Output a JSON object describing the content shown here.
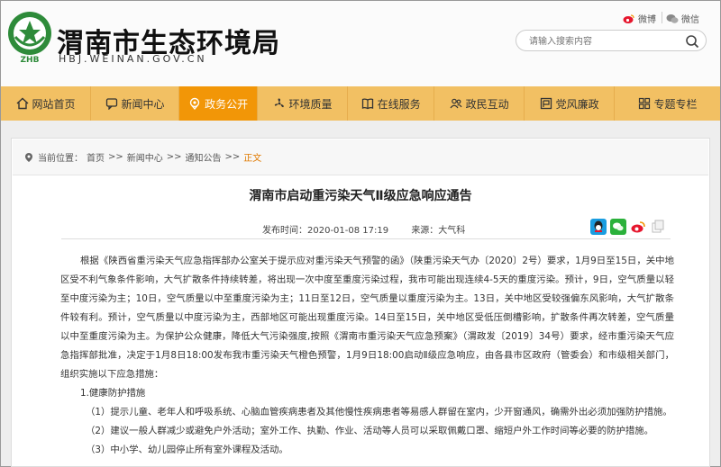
{
  "header": {
    "site_title": "渭南市生态环境局",
    "site_domain": "HBJ.WEINAN.GOV.CN",
    "emblem_text": "ZHB",
    "weibo_label": "微博",
    "wechat_label": "微信",
    "search_placeholder": "请输入搜索内容"
  },
  "nav": {
    "items": [
      {
        "label": "网站首页",
        "icon": "home-icon"
      },
      {
        "label": "新闻中心",
        "icon": "chat-icon"
      },
      {
        "label": "政务公开",
        "icon": "pin-icon",
        "active": true
      },
      {
        "label": "环境质量",
        "icon": "fan-icon"
      },
      {
        "label": "在线服务",
        "icon": "book-icon"
      },
      {
        "label": "政民互动",
        "icon": "people-icon"
      },
      {
        "label": "党风廉政",
        "icon": "flag-icon"
      },
      {
        "label": "专题专栏",
        "icon": "grid-icon"
      }
    ]
  },
  "breadcrumb": {
    "prefix": "当前位置：",
    "items": [
      "首页",
      ">>",
      "新闻中心",
      ">>",
      "通知公告",
      ">>"
    ],
    "current": "正文"
  },
  "article": {
    "title": "渭南市启动重污染天气Ⅱ级应急响应通告",
    "published": "发布时间：2020-01-08 17:19",
    "source": "来源：大气科",
    "paragraph1": "根据《陕西省重污染天气应急指挥部办公室关于提示应对重污染天气预警的函》（陕重污染天气办〔2020〕2号）要求，1月9日至15日，关中地区受不利气象条件影响，大气扩散条件持续转差，将出现一次中度至重度污染过程，我市可能出现连续4-5天的重度污染。预计，9日，空气质量以轻至中度污染为主；10日，空气质量以中至重度污染为主；11日至12日，空气质量以重度污染为主。13日，关中地区受较强偏东风影响，大气扩散条件较有利。预计，空气质量以中度污染为主，西部地区可能出现重度污染。14日至15日，关中地区受低压倒槽影响，扩散条件再次转差，空气质量以中至重度污染为主。为保护公众健康，降低大气污染强度,按照《渭南市重污染天气应急预案》（渭政发〔2019〕34号）要求，经市重污染天气应急指挥部批准，决定于1月8日18:00发布我市重污染天气橙色预警，1月9日18:00启动Ⅱ级应急响应，由各县市区政府（管委会）和市级相关部门，组织实施以下应急措施：",
    "heading1": "1.健康防护措施",
    "item1": "（1）提示儿童、老年人和呼吸系统、心脑血管疾病患者及其他慢性疾病患者等易感人群留在室内，少开窗通风，确需外出必须加强防护措施。",
    "item2": "（2）建议一般人群减少或避免户外活动；室外工作、执勤、作业、活动等人员可以采取佩戴口罩、缩短户外工作时间等必要的防护措施。",
    "item3": "（3）中小学、幼儿园停止所有室外课程及活动。"
  },
  "colors": {
    "nav_bg": "#f2c063",
    "nav_active": "#f29607",
    "emblem_green": "#2e8b3a",
    "crumb_current": "#e07a00"
  }
}
